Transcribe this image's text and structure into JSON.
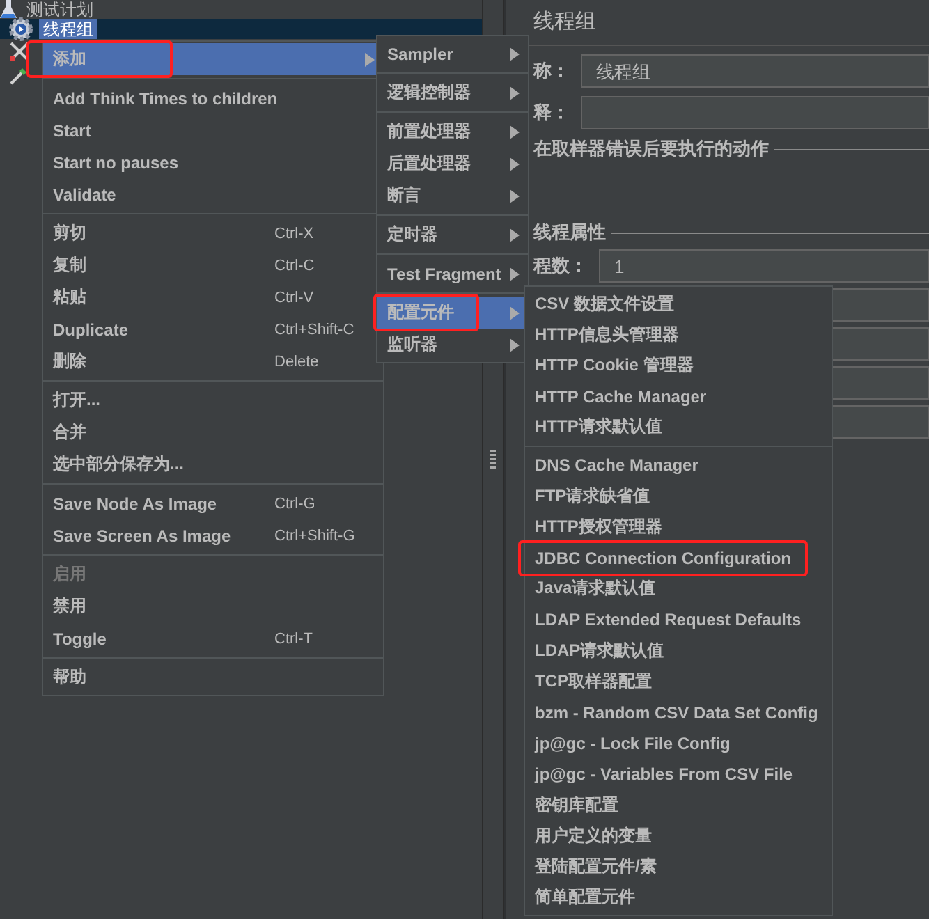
{
  "tree": {
    "items": [
      {
        "label": "测试计划",
        "selected": false
      },
      {
        "label": "线程组",
        "selected": true
      }
    ]
  },
  "panel": {
    "title": "线程组",
    "name_label": "称：",
    "name_value": "线程组",
    "comment_label": "释：",
    "error_group": "在取样器错误后要执行的动作",
    "props_group": "线程属性",
    "threads_label": "程数：",
    "threads_value": "1",
    "more_fields": [
      {
        "kind": "field"
      },
      {
        "kind": "field"
      },
      {
        "kind": "field"
      },
      {
        "kind": "field"
      }
    ]
  },
  "context_menu": [
    [
      {
        "label": "添加",
        "submenu": true,
        "selected": true,
        "disabled": false,
        "annotated": true
      }
    ],
    [
      {
        "label": "Add Think Times to children",
        "submenu": false,
        "selected": false,
        "disabled": false,
        "annotated": false
      },
      {
        "label": "Start",
        "submenu": false,
        "selected": false,
        "disabled": false,
        "annotated": false
      },
      {
        "label": "Start no pauses",
        "submenu": false,
        "selected": false,
        "disabled": false,
        "annotated": false
      },
      {
        "label": "Validate",
        "submenu": false,
        "selected": false,
        "disabled": false,
        "annotated": false
      }
    ],
    [
      {
        "label": "剪切",
        "shortcut": "Ctrl-X",
        "submenu": false,
        "selected": false,
        "disabled": false,
        "annotated": false
      },
      {
        "label": "复制",
        "shortcut": "Ctrl-C",
        "submenu": false,
        "selected": false,
        "disabled": false,
        "annotated": false
      },
      {
        "label": "粘贴",
        "shortcut": "Ctrl-V",
        "submenu": false,
        "selected": false,
        "disabled": false,
        "annotated": false
      },
      {
        "label": "Duplicate",
        "shortcut": "Ctrl+Shift-C",
        "submenu": false,
        "selected": false,
        "disabled": false,
        "annotated": false
      },
      {
        "label": "删除",
        "shortcut": "Delete",
        "submenu": false,
        "selected": false,
        "disabled": false,
        "annotated": false
      }
    ],
    [
      {
        "label": "打开...",
        "submenu": false,
        "selected": false,
        "disabled": false,
        "annotated": false
      },
      {
        "label": "合并",
        "submenu": false,
        "selected": false,
        "disabled": false,
        "annotated": false
      },
      {
        "label": "选中部分保存为...",
        "submenu": false,
        "selected": false,
        "disabled": false,
        "annotated": false
      }
    ],
    [
      {
        "label": "Save Node As Image",
        "shortcut": "Ctrl-G",
        "submenu": false,
        "selected": false,
        "disabled": false,
        "annotated": false
      },
      {
        "label": "Save Screen As Image",
        "shortcut": "Ctrl+Shift-G",
        "submenu": false,
        "selected": false,
        "disabled": false,
        "annotated": false
      }
    ],
    [
      {
        "label": "启用",
        "submenu": false,
        "selected": false,
        "disabled": true,
        "annotated": false
      },
      {
        "label": "禁用",
        "submenu": false,
        "selected": false,
        "disabled": false,
        "annotated": false
      },
      {
        "label": "Toggle",
        "shortcut": "Ctrl-T",
        "submenu": false,
        "selected": false,
        "disabled": false,
        "annotated": false
      }
    ],
    [
      {
        "label": "帮助",
        "submenu": false,
        "selected": false,
        "disabled": false,
        "annotated": false
      }
    ]
  ],
  "add_submenu": [
    [
      {
        "label": "Sampler",
        "submenu": true,
        "selected": false,
        "disabled": false,
        "annotated": false
      }
    ],
    [
      {
        "label": "逻辑控制器",
        "submenu": true,
        "selected": false,
        "disabled": false,
        "annotated": false
      }
    ],
    [
      {
        "label": "前置处理器",
        "submenu": true,
        "selected": false,
        "disabled": false,
        "annotated": false
      },
      {
        "label": "后置处理器",
        "submenu": true,
        "selected": false,
        "disabled": false,
        "annotated": false
      },
      {
        "label": "断言",
        "submenu": true,
        "selected": false,
        "disabled": false,
        "annotated": false
      }
    ],
    [
      {
        "label": "定时器",
        "submenu": true,
        "selected": false,
        "disabled": false,
        "annotated": false
      }
    ],
    [
      {
        "label": "Test Fragment",
        "submenu": true,
        "selected": false,
        "disabled": false,
        "annotated": false
      }
    ],
    [
      {
        "label": "配置元件",
        "submenu": true,
        "selected": true,
        "disabled": false,
        "annotated": true
      },
      {
        "label": "监听器",
        "submenu": true,
        "selected": false,
        "disabled": false,
        "annotated": false
      }
    ]
  ],
  "config_submenu": [
    [
      {
        "label": "CSV 数据文件设置",
        "submenu": false,
        "selected": false,
        "disabled": false,
        "annotated": false
      },
      {
        "label": "HTTP信息头管理器",
        "submenu": false,
        "selected": false,
        "disabled": false,
        "annotated": false
      },
      {
        "label": "HTTP Cookie 管理器",
        "submenu": false,
        "selected": false,
        "disabled": false,
        "annotated": false
      },
      {
        "label": "HTTP Cache Manager",
        "submenu": false,
        "selected": false,
        "disabled": false,
        "annotated": false
      },
      {
        "label": "HTTP请求默认值",
        "submenu": false,
        "selected": false,
        "disabled": false,
        "annotated": false
      }
    ],
    [
      {
        "label": "DNS Cache Manager",
        "submenu": false,
        "selected": false,
        "disabled": false,
        "annotated": false
      },
      {
        "label": "FTP请求缺省值",
        "submenu": false,
        "selected": false,
        "disabled": false,
        "annotated": false
      },
      {
        "label": "HTTP授权管理器",
        "submenu": false,
        "selected": false,
        "disabled": false,
        "annotated": false
      },
      {
        "label": "JDBC Connection Configuration",
        "submenu": false,
        "selected": false,
        "disabled": false,
        "annotated": true
      },
      {
        "label": "Java请求默认值",
        "submenu": false,
        "selected": false,
        "disabled": false,
        "annotated": false
      },
      {
        "label": "LDAP Extended Request Defaults",
        "submenu": false,
        "selected": false,
        "disabled": false,
        "annotated": false
      },
      {
        "label": "LDAP请求默认值",
        "submenu": false,
        "selected": false,
        "disabled": false,
        "annotated": false
      },
      {
        "label": "TCP取样器配置",
        "submenu": false,
        "selected": false,
        "disabled": false,
        "annotated": false
      },
      {
        "label": "bzm - Random CSV Data Set Config",
        "submenu": false,
        "selected": false,
        "disabled": false,
        "annotated": false
      },
      {
        "label": "jp@gc - Lock File Config",
        "submenu": false,
        "selected": false,
        "disabled": false,
        "annotated": false
      },
      {
        "label": "jp@gc - Variables From CSV File",
        "submenu": false,
        "selected": false,
        "disabled": false,
        "annotated": false
      },
      {
        "label": "密钥库配置",
        "submenu": false,
        "selected": false,
        "disabled": false,
        "annotated": false
      },
      {
        "label": "用户定义的变量",
        "submenu": false,
        "selected": false,
        "disabled": false,
        "annotated": false
      },
      {
        "label": "登陆配置元件/素",
        "submenu": false,
        "selected": false,
        "disabled": false,
        "annotated": false
      },
      {
        "label": "简单配置元件",
        "submenu": false,
        "selected": false,
        "disabled": false,
        "annotated": false
      }
    ]
  ]
}
